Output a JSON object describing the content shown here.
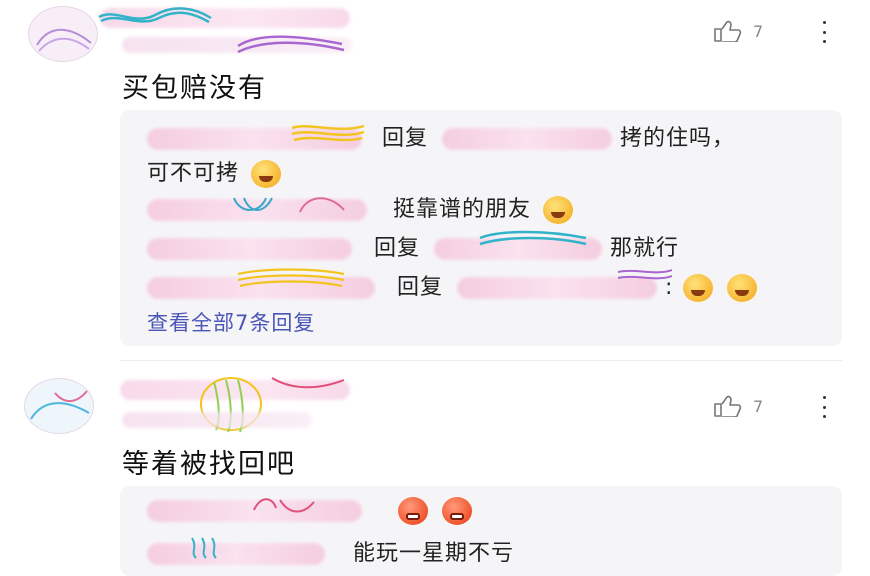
{
  "comments": [
    {
      "text": "买包赔没有",
      "likes": "7",
      "replies": [
        {
          "segments": [
            "回复",
            "拷的住吗，"
          ]
        },
        {
          "segments": [
            "可不可拷"
          ]
        },
        {
          "segments": [
            "挺靠谱的朋友"
          ]
        },
        {
          "segments": [
            "回复",
            "那就行"
          ]
        },
        {
          "segments": [
            "回复",
            ":"
          ]
        }
      ],
      "view_all": "查看全部7条回复"
    },
    {
      "text": "等着被找回吧",
      "likes": "7",
      "replies": [
        {
          "segments": []
        },
        {
          "segments": [
            "能玩一星期不亏"
          ]
        }
      ]
    }
  ],
  "icons": {
    "like": "thumbs-up-icon",
    "more": "more-vertical-icon",
    "emoji_grin": "grinning-emoji",
    "emoji_laugh": "laughing-emoji",
    "emoji_angry": "angry-emoji"
  },
  "colors": {
    "link": "#4a55b8",
    "reply_bg": "#f5f5f7",
    "text": "#111111",
    "muted": "#888888"
  }
}
